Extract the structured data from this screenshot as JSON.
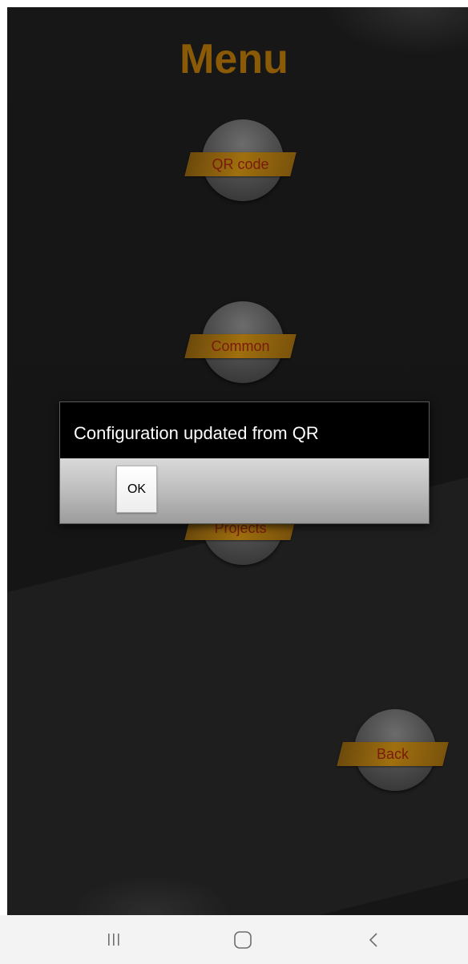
{
  "app": {
    "title": "Menu",
    "colors": {
      "title": "#8a5a06",
      "tag": "#a0700f",
      "tag_text": "#7a1a0a",
      "background": "#161616"
    }
  },
  "menu": {
    "items": [
      {
        "label": "QR code"
      },
      {
        "label": "Common"
      },
      {
        "label": "Projects"
      }
    ],
    "back_label": "Back"
  },
  "dialog": {
    "message": "Configuration updated from QR",
    "ok_label": "OK"
  },
  "nav_bar": {
    "buttons": [
      {
        "icon": "recent-apps-icon"
      },
      {
        "icon": "home-icon"
      },
      {
        "icon": "back-chevron-icon"
      }
    ]
  }
}
